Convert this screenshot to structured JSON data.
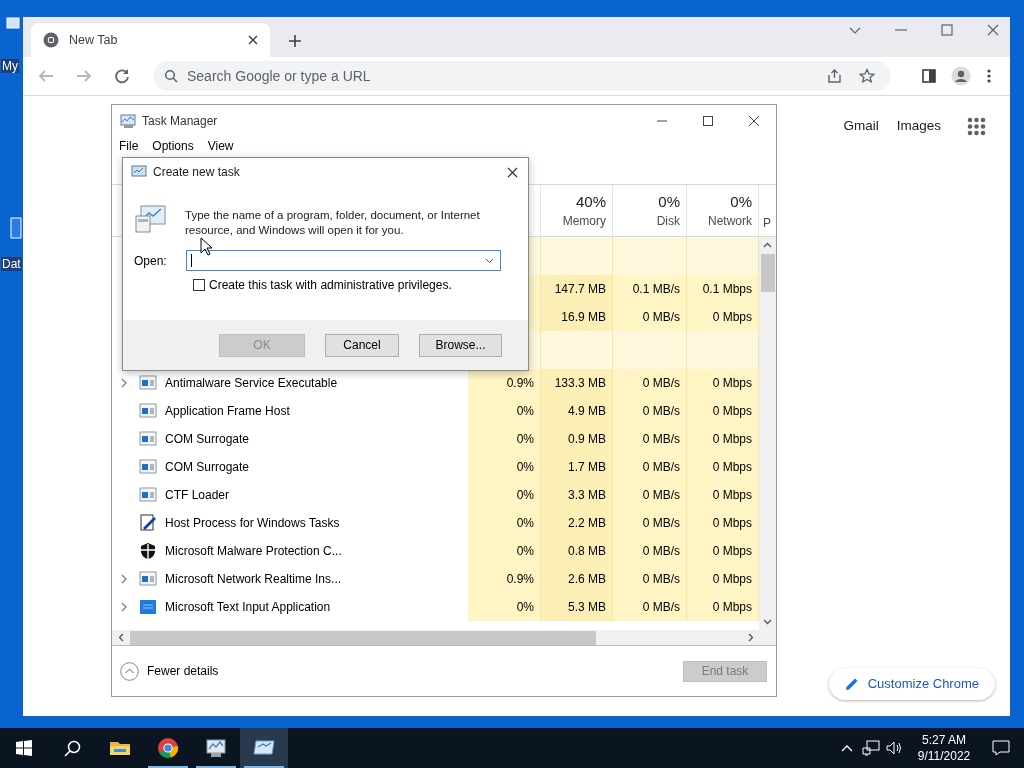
{
  "desktop": {
    "icon_labels": [
      "My",
      "Dat"
    ]
  },
  "browser": {
    "tabs": [
      {
        "title": "New Tab",
        "selected": true
      }
    ],
    "nav": [
      {
        "kind": "back",
        "disabled": true
      },
      {
        "kind": "forward",
        "disabled": true
      },
      {
        "kind": "reload",
        "disabled": false
      }
    ],
    "omnibox": {
      "placeholder": "Search Google or type a URL"
    },
    "links": [
      "Gmail",
      "Images"
    ],
    "customize_button": "Customize Chrome"
  },
  "task_manager": {
    "title": "Task Manager",
    "menu": [
      "File",
      "Options",
      "View"
    ],
    "columns": [
      {
        "kind": "cpu"
      },
      {
        "kind": "memory",
        "percent": "40%",
        "label": "Memory"
      },
      {
        "kind": "disk",
        "percent": "0%",
        "label": "Disk"
      },
      {
        "kind": "network",
        "percent": "0%",
        "label": "Network"
      }
    ],
    "cut_column_label": "P",
    "rows": [
      {
        "kind": "group"
      },
      {
        "kind": "process",
        "memory": "147.7 MB",
        "disk": "0.1 MB/s",
        "network": "0.1 Mbps"
      },
      {
        "kind": "process",
        "memory": "16.9 MB",
        "disk": "0 MB/s",
        "network": "0 Mbps"
      },
      {
        "kind": "group"
      },
      {
        "kind": "process",
        "name": "Antimalware Service Executable",
        "expanded": false,
        "cpu": "0.9%",
        "memory": "133.3 MB",
        "disk": "0 MB/s",
        "network": "0 Mbps"
      },
      {
        "kind": "process",
        "name": "Application Frame Host",
        "cpu": "0%",
        "memory": "4.9 MB",
        "disk": "0 MB/s",
        "network": "0 Mbps"
      },
      {
        "kind": "process",
        "name": "COM Surrogate",
        "cpu": "0%",
        "memory": "0.9 MB",
        "disk": "0 MB/s",
        "network": "0 Mbps"
      },
      {
        "kind": "process",
        "name": "COM Surrogate",
        "cpu": "0%",
        "memory": "1.7 MB",
        "disk": "0 MB/s",
        "network": "0 Mbps"
      },
      {
        "kind": "process",
        "name": "CTF Loader",
        "cpu": "0%",
        "memory": "3.3 MB",
        "disk": "0 MB/s",
        "network": "0 Mbps"
      },
      {
        "kind": "process",
        "name": "Host Process for Windows Tasks",
        "cpu": "0%",
        "memory": "2.2 MB",
        "disk": "0 MB/s",
        "network": "0 Mbps"
      },
      {
        "kind": "process",
        "name": "Microsoft Malware Protection C...",
        "cpu": "0%",
        "memory": "0.8 MB",
        "disk": "0 MB/s",
        "network": "0 Mbps"
      },
      {
        "kind": "process",
        "name": "Microsoft Network Realtime Ins...",
        "expanded": false,
        "cpu": "0.9%",
        "memory": "2.6 MB",
        "disk": "0 MB/s",
        "network": "0 Mbps"
      },
      {
        "kind": "process",
        "name": "Microsoft Text Input Application",
        "expanded": false,
        "cpu": "0%",
        "memory": "5.3 MB",
        "disk": "0 MB/s",
        "network": "0 Mbps"
      }
    ],
    "fewer_details": "Fewer details",
    "end_task": {
      "label": "End task",
      "disabled": true
    }
  },
  "dialog": {
    "title": "Create new task",
    "message": "Type the name of a program, folder, document, or Internet resource, and Windows will open it for you.",
    "open_label": "Open:",
    "admin_checkbox": {
      "label": "Create this task with administrative privileges.",
      "checked": false
    },
    "buttons": [
      {
        "label": "OK",
        "disabled": true
      },
      {
        "label": "Cancel",
        "disabled": false
      },
      {
        "label": "Browse...",
        "disabled": false
      }
    ]
  },
  "taskbar": {
    "apps": [
      {
        "kind": "explorer",
        "running": false,
        "active": false
      },
      {
        "kind": "chrome",
        "running": true,
        "active": false
      },
      {
        "kind": "taskmgr",
        "running": true,
        "active": false
      },
      {
        "kind": "run",
        "running": true,
        "active": true
      }
    ],
    "time": "5:27 AM",
    "date": "9/11/2022"
  }
}
